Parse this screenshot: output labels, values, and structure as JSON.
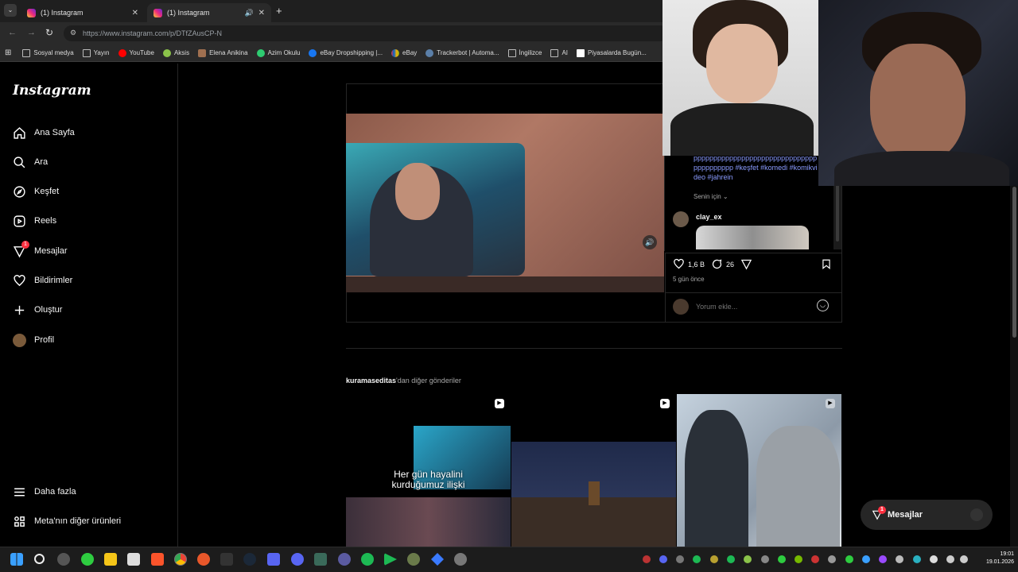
{
  "browser": {
    "tabs": [
      {
        "title": "(1) Instagram",
        "active": false
      },
      {
        "title": "(1) Instagram",
        "active": true
      }
    ],
    "url": "https://www.instagram.com/p/DTfZAusCP-N",
    "bookmarks": [
      "Sosyal medya",
      "Yayın",
      "YouTube",
      "Aksis",
      "Elena Anikina",
      "Azim Okulu",
      "eBay Dropshipping |...",
      "eBay",
      "Trackerbot | Automa...",
      "İngilizce",
      "AI",
      "Piyasalarda Bugün..."
    ]
  },
  "sidebar": {
    "logo": "Instagram",
    "items": [
      {
        "label": "Ana Sayfa",
        "icon": "home-icon"
      },
      {
        "label": "Ara",
        "icon": "search-icon"
      },
      {
        "label": "Keşfet",
        "icon": "compass-icon"
      },
      {
        "label": "Reels",
        "icon": "reels-icon"
      },
      {
        "label": "Mesajlar",
        "icon": "messenger-icon",
        "badge": "1"
      },
      {
        "label": "Bildirimler",
        "icon": "heart-icon"
      },
      {
        "label": "Oluştur",
        "icon": "plus-icon"
      },
      {
        "label": "Profil",
        "icon": "avatar-icon"
      }
    ],
    "bottom": [
      {
        "label": "Daha fazla",
        "icon": "menu-icon"
      },
      {
        "label": "Meta'nın diğer ürünleri",
        "icon": "apps-icon"
      }
    ]
  },
  "post": {
    "caption": "ppppppppppppppppppppppppppppppppppppppppp #keşfet #komedi #komikvideo #jahrein",
    "sort": "Senin için",
    "comment_user": "clay_ex",
    "likes": "1,6 B",
    "comments": "26",
    "time_ago": "5 gün önce",
    "add_comment_placeholder": "Yorum ekle..."
  },
  "more": {
    "user": "kuramaseditas",
    "suffix": "'dan diğer gönderiler",
    "thumb1_caption_line1": "Her gün hayalini",
    "thumb1_caption_line2": "kurduğumuz ilişki"
  },
  "messages_pill": {
    "label": "Mesajlar",
    "badge": "1"
  },
  "taskbar": {
    "time": "19:01",
    "date": "19.01.2026"
  }
}
